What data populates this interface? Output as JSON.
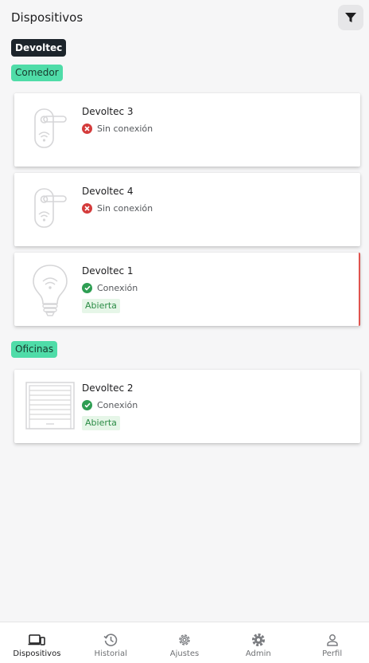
{
  "header": {
    "title": "Dispositivos",
    "filter_icon": "filter-icon"
  },
  "brand": "Devoltec",
  "groups": [
    {
      "label": "Comedor",
      "devices": [
        {
          "name": "Devoltec 3",
          "icon": "door-handle-icon",
          "status": "Sin conexión",
          "status_type": "error"
        },
        {
          "name": "Devoltec 4",
          "icon": "door-handle-icon",
          "status": "Sin conexión",
          "status_type": "error"
        },
        {
          "name": "Devoltec 1",
          "icon": "bulb-icon",
          "status": "Conexión",
          "status_type": "ok",
          "state": "Abierta"
        }
      ]
    },
    {
      "label": "Oficinas",
      "devices": [
        {
          "name": "Devoltec 2",
          "icon": "garage-door-icon",
          "status": "Conexión",
          "status_type": "ok",
          "state": "Abierta"
        }
      ]
    }
  ],
  "nav": [
    {
      "label": "Dispositivos",
      "icon": "devices-icon",
      "active": true
    },
    {
      "label": "Historial",
      "icon": "history-icon"
    },
    {
      "label": "Ajustes",
      "icon": "settings-icon"
    },
    {
      "label": "Admin",
      "icon": "admin-gear-icon"
    },
    {
      "label": "Perfil",
      "icon": "profile-icon"
    }
  ],
  "colors": {
    "accent": "#4fdca8",
    "dark": "#1c242b",
    "error": "#d43b3b",
    "ok": "#2e9e53",
    "selected_border": "#e0534e"
  }
}
